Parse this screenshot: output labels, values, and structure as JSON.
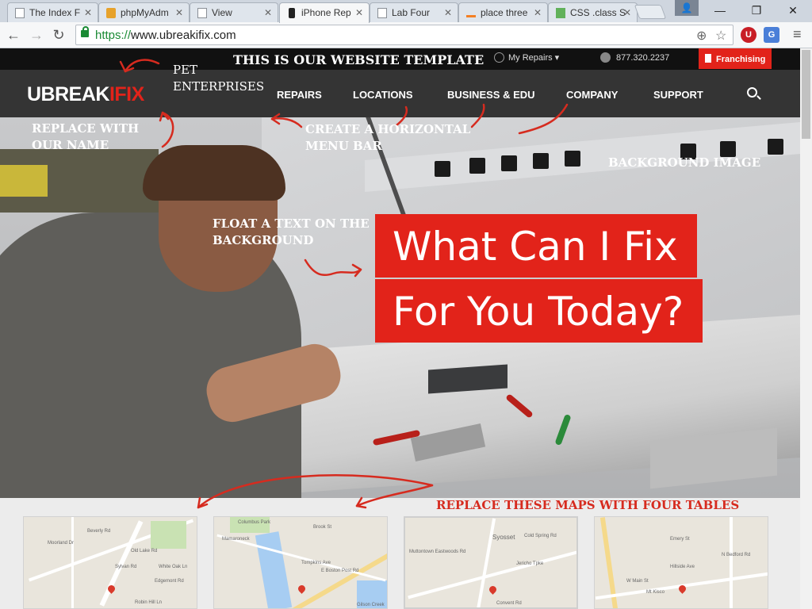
{
  "browser": {
    "tabs": [
      {
        "title": "The Index F",
        "icon": "page-icon",
        "active": false
      },
      {
        "title": "phpMyAdm",
        "icon": "phpmyadmin-icon",
        "active": false
      },
      {
        "title": "View",
        "icon": "page-icon",
        "active": false
      },
      {
        "title": "iPhone Rep",
        "icon": "phone-icon",
        "active": true
      },
      {
        "title": "Lab Four",
        "icon": "page-icon",
        "active": false
      },
      {
        "title": "place three",
        "icon": "stackoverflow-icon",
        "active": false
      },
      {
        "title": "CSS .class S",
        "icon": "w3schools-icon",
        "active": false
      }
    ],
    "window_buttons": {
      "minimize": "—",
      "restore": "❐",
      "close": "✕"
    },
    "address": {
      "scheme": "https://",
      "host": "www.ubreakifix.com"
    },
    "nav": {
      "back": "←",
      "forward": "→",
      "reload": "↻",
      "menu": "≡"
    }
  },
  "site": {
    "top_bar": {
      "my_repairs": "My Repairs ▾",
      "phone": "877.320.2237",
      "franchising": "Franchising"
    },
    "logo": {
      "part1": "UBREAK",
      "part2": "IFIX"
    },
    "nav": [
      "REPAIRS",
      "LOCATIONS",
      "BUSINESS & EDU",
      "COMPANY",
      "SUPPORT"
    ],
    "hero": {
      "line1": "What Can I Fix",
      "line2": "For You Today?"
    },
    "maps": [
      {
        "labels": [
          "Moorland Dr",
          "Beverly Rd",
          "Old Lake Rd",
          "Sylvan Rd",
          "White Oak Ln",
          "Edgemont Rd",
          "Robin Hill Ln"
        ]
      },
      {
        "labels": [
          "Columbus Park",
          "Mamaroneck",
          "Tompkins Ave",
          "Brook St",
          "E Boston Post Rd",
          "Gilson Creek"
        ]
      },
      {
        "labels": [
          "Syosset",
          "Muttontown Eastwoods Rd",
          "Cold Spring Rd",
          "Jericho Tpke",
          "Convent Rd"
        ]
      },
      {
        "labels": [
          "Emery St",
          "Hillside Ave",
          "Mt Kisco",
          "W Main St",
          "N Bedford Rd"
        ]
      }
    ]
  },
  "annotations": {
    "title": "THIS IS OUR WEBSITE TEMPLATE",
    "pet": "PET ENTERPRISES",
    "replace_name": "REPLACE WITH OUR NAME",
    "menu_bar": "CREATE A HORIZONTAL MENU BAR",
    "bg_image": "BACKGROUND IMAGE",
    "float_text": "FLOAT A TEXT ON THE BACKGROUND",
    "replace_maps": "REPLACE THESE MAPS WITH FOUR TABLES",
    "colors": {
      "ink": "#d62b1f",
      "brand_red": "#e2231a"
    }
  }
}
